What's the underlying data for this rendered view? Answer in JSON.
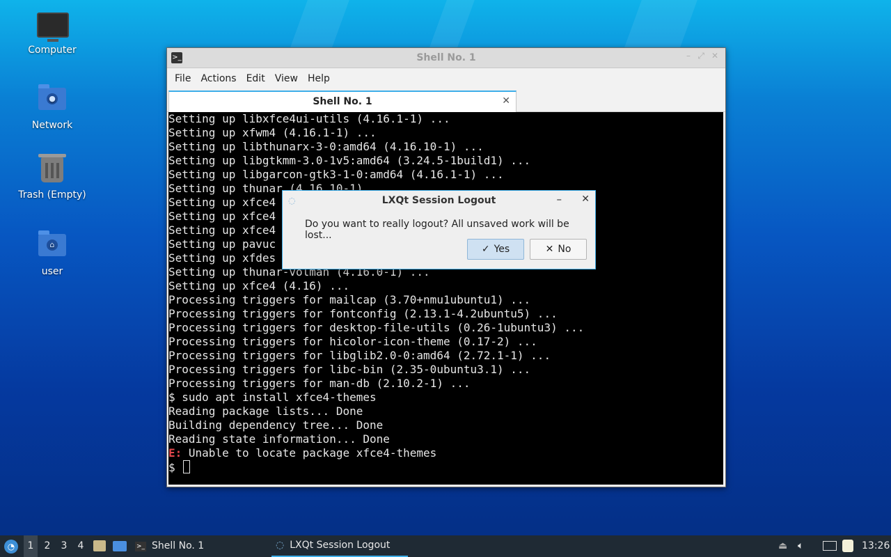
{
  "desktop": {
    "icons": [
      {
        "label": "Computer",
        "icon": "computer-icon"
      },
      {
        "label": "Network",
        "icon": "network-folder-icon"
      },
      {
        "label": "Trash (Empty)",
        "icon": "trash-icon"
      },
      {
        "label": "user",
        "icon": "home-folder-icon"
      }
    ]
  },
  "terminal": {
    "window_title": "Shell No. 1",
    "menu": [
      "File",
      "Actions",
      "Edit",
      "View",
      "Help"
    ],
    "tab_label": "Shell No. 1",
    "lines": [
      "Setting up libxfce4ui-utils (4.16.1-1) ...",
      "Setting up xfwm4 (4.16.1-1) ...",
      "Setting up libthunarx-3-0:amd64 (4.16.10-1) ...",
      "Setting up libgtkmm-3.0-1v5:amd64 (3.24.5-1build1) ...",
      "Setting up libgarcon-gtk3-1-0:amd64 (4.16.1-1) ...",
      "Setting up thunar (4.16.10-1) ...",
      "Setting up xfce4",
      "Setting up xfce4",
      "Setting up xfce4",
      "Setting up pavuc",
      "Setting up xfdes",
      "Setting up thunar-volman (4.16.0-1) ...",
      "Setting up xfce4 (4.16) ...",
      "Processing triggers for mailcap (3.70+nmu1ubuntu1) ...",
      "Processing triggers for fontconfig (2.13.1-4.2ubuntu5) ...",
      "Processing triggers for desktop-file-utils (0.26-1ubuntu3) ...",
      "Processing triggers for hicolor-icon-theme (0.17-2) ...",
      "Processing triggers for libglib2.0-0:amd64 (2.72.1-1) ...",
      "Processing triggers for libc-bin (2.35-0ubuntu3.1) ...",
      "Processing triggers for man-db (2.10.2-1) ...",
      "$ sudo apt install xfce4-themes",
      "Reading package lists... Done",
      "Building dependency tree... Done",
      "Reading state information... Done"
    ],
    "error_prefix": "E:",
    "error_text": " Unable to locate package xfce4-themes",
    "prompt": "$ "
  },
  "dialog": {
    "title": "LXQt Session Logout",
    "message": "Do you want to really logout? All unsaved work will be lost...",
    "yes_label": "Yes",
    "no_label": "No"
  },
  "taskbar": {
    "desktops": [
      "1",
      "2",
      "3",
      "4"
    ],
    "active_desktop": "1",
    "tasks": [
      "Shell No. 1",
      "LXQt Session Logout"
    ],
    "clock": "13:26"
  },
  "colors": {
    "accent": "#3daee9",
    "error": "#e5484d",
    "terminal_bg": "#000000"
  }
}
